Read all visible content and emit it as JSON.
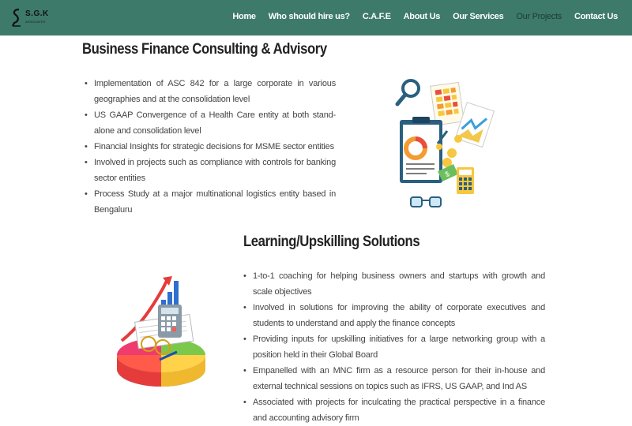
{
  "logo": {
    "text": "S.G.K",
    "sub": "ASSOCIATES"
  },
  "nav": {
    "items": [
      {
        "label": "Home"
      },
      {
        "label": "Who should hire us?"
      },
      {
        "label": "C.A.F.E"
      },
      {
        "label": "About Us"
      },
      {
        "label": "Our Services"
      },
      {
        "label": "Our Projects"
      },
      {
        "label": "Contact Us"
      }
    ]
  },
  "section1": {
    "title": "Business Finance Consulting & Advisory",
    "items": [
      "Implementation of ASC 842 for a large corporate in various geographies and at the consolidation level",
      "US GAAP Convergence of a Health Care entity at both stand-alone and consolidation level",
      "Financial Insights for strategic decisions for MSME sector entities",
      "Involved in projects such as compliance with controls for banking sector entities",
      "Process Study at a major multinational logistics entity based in Bengaluru"
    ]
  },
  "section2": {
    "title": "Learning/Upskilling Solutions",
    "items": [
      "1-to-1 coaching for helping business owners and startups with growth and scale objectives",
      "Involved in solutions for improving the ability of corporate executives and students to understand and apply the finance concepts",
      "Providing inputs for upskilling initiatives for a large networking group with a position held in their Global Board",
      "Empanelled with an MNC firm as a resource person for their in-house and external technical sessions on topics such as IFRS, US GAAP, and Ind AS",
      "Associated with projects for inculcating the practical perspective in a finance and accounting advisory firm"
    ]
  },
  "colors": {
    "navbar": "#3d7a6a",
    "active_nav": "#1f3b33"
  }
}
